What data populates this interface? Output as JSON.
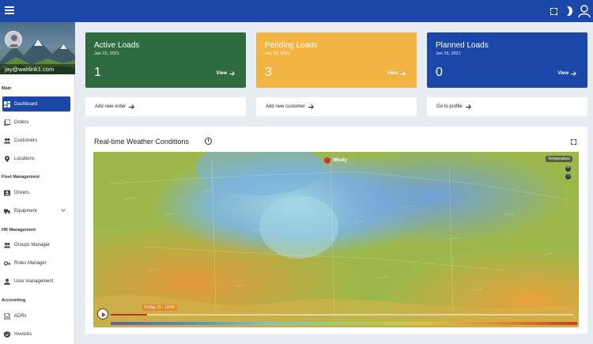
{
  "sidebar": {
    "email": "jay@waltlink1.com",
    "sections": {
      "main": "Main",
      "fleet": "Fleet Management",
      "hr": "HR Management",
      "accounting": "Accounting"
    },
    "items": [
      {
        "label": "Dashboard",
        "icon": "dashboard-icon"
      },
      {
        "label": "Orders",
        "icon": "orders-icon"
      },
      {
        "label": "Customers",
        "icon": "customers-icon"
      },
      {
        "label": "Locations",
        "icon": "location-icon"
      },
      {
        "label": "Drivers",
        "icon": "driver-badge-icon"
      },
      {
        "label": "Equipment",
        "icon": "truck-icon"
      },
      {
        "label": "Groups Manager",
        "icon": "groups-icon"
      },
      {
        "label": "Roles Manager",
        "icon": "key-icon"
      },
      {
        "label": "User management",
        "icon": "user-icon"
      },
      {
        "label": "ADRs",
        "icon": "document-icon"
      },
      {
        "label": "Invoices",
        "icon": "invoice-icon"
      }
    ]
  },
  "cards": [
    {
      "title": "Active Loads",
      "date": "Jan 15, 2021",
      "count": "1",
      "view": "View",
      "color": "#2e6b3f"
    },
    {
      "title": "Pending Loads",
      "date": "Jan 15, 2021",
      "count": "3",
      "view": "View",
      "color": "#f2b544"
    },
    {
      "title": "Planned Loads",
      "date": "Jan 15, 2021",
      "count": "0",
      "view": "View",
      "color": "#1a47a8"
    }
  ],
  "links": {
    "add_order": "Add new order",
    "add_customer": "Add new customer",
    "profile": "Go to profile"
  },
  "weather": {
    "title": "Real-time Weather Conditions",
    "info": "i",
    "windy": "Windy",
    "temperature": "Temperature",
    "zoom_in": "+",
    "zoom_out": "−",
    "date_chip": "Friday 15 - 18:00"
  },
  "colors": {
    "topbar": "#1a47a8",
    "active_nav": "#1a47a8"
  }
}
